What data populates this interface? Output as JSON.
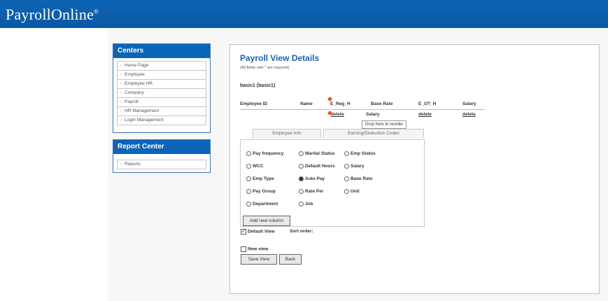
{
  "app": {
    "name": "PayrollOnline",
    "mark": "®"
  },
  "centers": {
    "title": "Centers",
    "items": [
      "Home Page",
      "Employee",
      "Employee HR",
      "Company",
      "Payroll",
      "HR Management",
      "Login Management"
    ]
  },
  "report_center": {
    "title": "Report Center",
    "items": [
      "Reports"
    ]
  },
  "main": {
    "title": "Payroll View Details",
    "required_note": "(All fields with * are required)",
    "view_name": "basic1 (basic1)",
    "columns": [
      "Employee ID",
      "Name",
      "E_Reg_H",
      "Base Rate",
      "E_OT_H",
      "Salary"
    ],
    "delete_label": "delete",
    "dragging_label": "Salary",
    "tooltip": "Drop here to reorder",
    "tabs": [
      "Employee Info",
      "Earning/Deduction Codes"
    ],
    "options": [
      {
        "label": "Pay frequency",
        "selected": false
      },
      {
        "label": "Marital Status",
        "selected": false
      },
      {
        "label": "Emp Status",
        "selected": false
      },
      {
        "label": "WCC",
        "selected": false
      },
      {
        "label": "Default Hours",
        "selected": false
      },
      {
        "label": "Salary",
        "selected": false
      },
      {
        "label": "Emp Type",
        "selected": false
      },
      {
        "label": "Auto Pay",
        "selected": true
      },
      {
        "label": "Base Rate",
        "selected": false
      },
      {
        "label": "Pay Group",
        "selected": false
      },
      {
        "label": "Rate Per",
        "selected": false
      },
      {
        "label": "Unit",
        "selected": false
      },
      {
        "label": "Department",
        "selected": false
      },
      {
        "label": "Job",
        "selected": false
      }
    ],
    "add_column_label": "Add new column",
    "default_view_label": "Default View",
    "default_view_checked": true,
    "sort_order_label": "Sort order:",
    "new_view_label": "New view",
    "new_view_checked": false,
    "save_label": "Save View",
    "back_label": "Back"
  }
}
